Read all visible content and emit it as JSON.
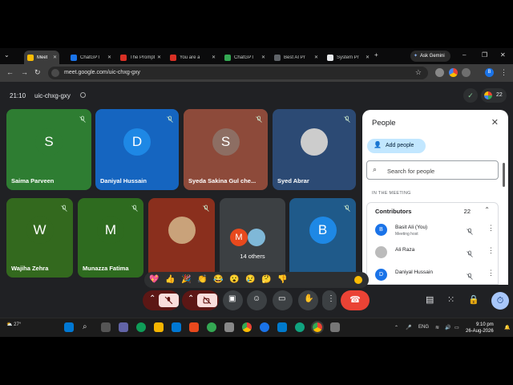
{
  "browser": {
    "tabs": [
      {
        "label": "Meet",
        "color": "#fbbc04",
        "active": true
      },
      {
        "label": "ChatGPT",
        "color": "#1a73e8"
      },
      {
        "label": "The Prompt",
        "color": "#d93025"
      },
      {
        "label": "You are a",
        "color": "#d93025"
      },
      {
        "label": "ChatGPT",
        "color": "#34a853"
      },
      {
        "label": "Best AI Pr",
        "color": "#5f6368"
      },
      {
        "label": "System Pr",
        "color": "#e8eaed"
      }
    ],
    "ask_gemini": "Ask Gemini",
    "url": "meet.google.com/uic-chxg-gxy",
    "profile_initial": "B"
  },
  "meet": {
    "time": "21:10",
    "meeting_code": "uic-chxg-gxy",
    "participant_count": "22",
    "tiles": [
      {
        "name": "Saima Parveen",
        "initial": "S",
        "bg": "#2e7d32",
        "avatar": "#2e7d32"
      },
      {
        "name": "Daniyal Hussain",
        "initial": "D",
        "bg": "#1565c0",
        "avatar": "#1e88e5"
      },
      {
        "name": "Syeda Sakina Gul che...",
        "initial": "S",
        "bg": "#8d4a3a",
        "avatar": "#8d6e63"
      },
      {
        "name": "Syed Abrar",
        "initial": "",
        "bg": "#2c4a74",
        "avatar": "#cccccc"
      },
      {
        "name": "Wajiha Zehra",
        "initial": "W",
        "bg": "#33691e",
        "avatar": "#33691e"
      },
      {
        "name": "Munazza Fatima",
        "initial": "M",
        "bg": "#2e6b1f",
        "avatar": "#2e6b1f"
      },
      {
        "name": "",
        "initial": "",
        "bg": "#8a2f1d",
        "avatar": "#c9a27a"
      },
      {
        "name": "14 others",
        "initial": "M",
        "bg": "#3c4043",
        "avatar": "#e8491d"
      },
      {
        "name": "",
        "initial": "B",
        "bg": "#1f5a8a",
        "avatar": "#1e88e5"
      }
    ],
    "reactions": [
      "💖",
      "👍",
      "🎉",
      "👏",
      "😂",
      "😮",
      "😢",
      "🤔",
      "👎"
    ]
  },
  "people_panel": {
    "title": "People",
    "add_people": "Add people",
    "search_placeholder": "Search for people",
    "section": "IN THE MEETING",
    "contributors_label": "Contributors",
    "contributors_count": "22",
    "people": [
      {
        "name": "Basit Ali (You)",
        "role": "Meeting host",
        "initial": "B"
      },
      {
        "name": "Ali Raza",
        "role": "",
        "initial": ""
      },
      {
        "name": "Daniyal Hussain",
        "role": "",
        "initial": "D"
      }
    ]
  },
  "taskbar": {
    "weather": "27°",
    "lang": "ENG",
    "time": "9:10 pm",
    "date": "26-Aug-2026"
  }
}
